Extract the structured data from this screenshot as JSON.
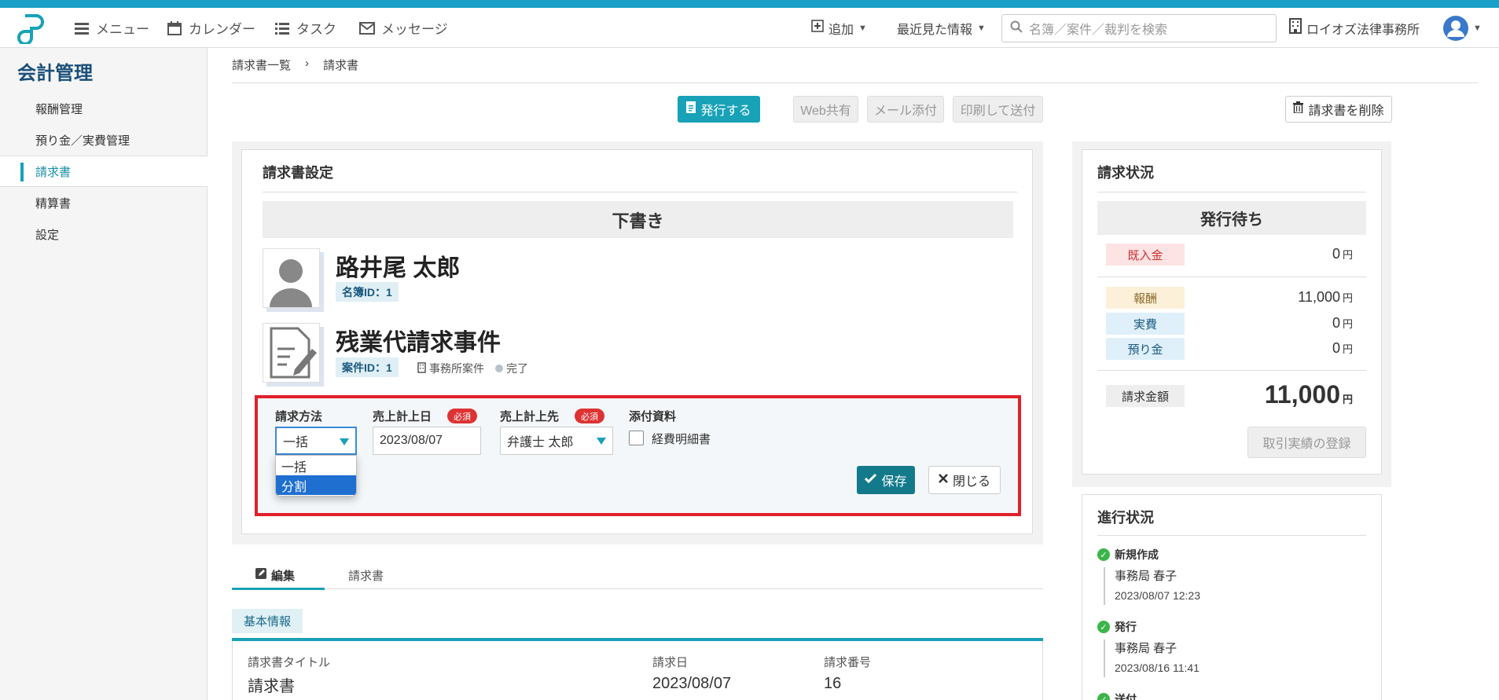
{
  "header": {
    "nav": {
      "menu": "メニュー",
      "calendar": "カレンダー",
      "tasks": "タスク",
      "messages": "メッセージ"
    },
    "add_label": "追加",
    "recent_label": "最近見た情報",
    "search_placeholder": "名簿／案件／裁判を検索",
    "office_name": "ロイオズ法律事務所"
  },
  "sidebar": {
    "title": "会計管理",
    "items": [
      {
        "label": "報酬管理"
      },
      {
        "label": "預り金／実費管理"
      },
      {
        "label": "請求書"
      },
      {
        "label": "精算書"
      },
      {
        "label": "設定"
      }
    ]
  },
  "breadcrumb": {
    "parent": "請求書一覧",
    "separator": "›",
    "current": "請求書"
  },
  "toolbar": {
    "issue": "発行する",
    "web_share": "Web共有",
    "mail_attach": "メール添付",
    "print_send": "印刷して送付",
    "delete": "請求書を削除"
  },
  "invoice_settings": {
    "title": "請求書設定",
    "status": "下書き",
    "client_name": "路井尾 太郎",
    "client_id": "名簿ID：1",
    "case_name": "残業代請求事件",
    "case_id": "案件ID：1",
    "case_type": "事務所案件",
    "case_status": "完了"
  },
  "edit_form": {
    "method_label": "請求方法",
    "method_value": "一括",
    "method_options": [
      "一括",
      "分割"
    ],
    "date_label": "売上計上日",
    "date_value": "2023/08/07",
    "target_label": "売上計上先",
    "target_value": "弁護士 太郎",
    "required": "必須",
    "attach_label": "添付資料",
    "attach_option": "経費明細書",
    "save": "保存",
    "close": "閉じる"
  },
  "tabs": {
    "edit": "編集",
    "invoice": "請求書"
  },
  "basic_info": {
    "section": "基本情報",
    "title_label": "請求書タイトル",
    "title_value": "請求書",
    "date_label": "請求日",
    "date_value": "2023/08/07",
    "number_label": "請求番号",
    "number_value": "16"
  },
  "billing_status": {
    "title": "請求状況",
    "status": "発行待ち",
    "received_label": "既入金",
    "received_value": "0",
    "fee_label": "報酬",
    "fee_value": "11,000",
    "expense_label": "実費",
    "expense_value": "0",
    "deposit_label": "預り金",
    "deposit_value": "0",
    "total_label": "請求金額",
    "total_value": "11,000",
    "yen": "円",
    "register_button": "取引実績の登録"
  },
  "progress": {
    "title": "進行状況",
    "steps": [
      {
        "label": "新規作成",
        "user": "事務局 春子",
        "time": "2023/08/07 12:23"
      },
      {
        "label": "発行",
        "user": "事務局 春子",
        "time": "2023/08/16 11:41"
      },
      {
        "label": "送付"
      }
    ]
  },
  "colors": {
    "accent": "#17a2b8",
    "highlight_border": "#e0202a",
    "required": "#dd3333"
  }
}
